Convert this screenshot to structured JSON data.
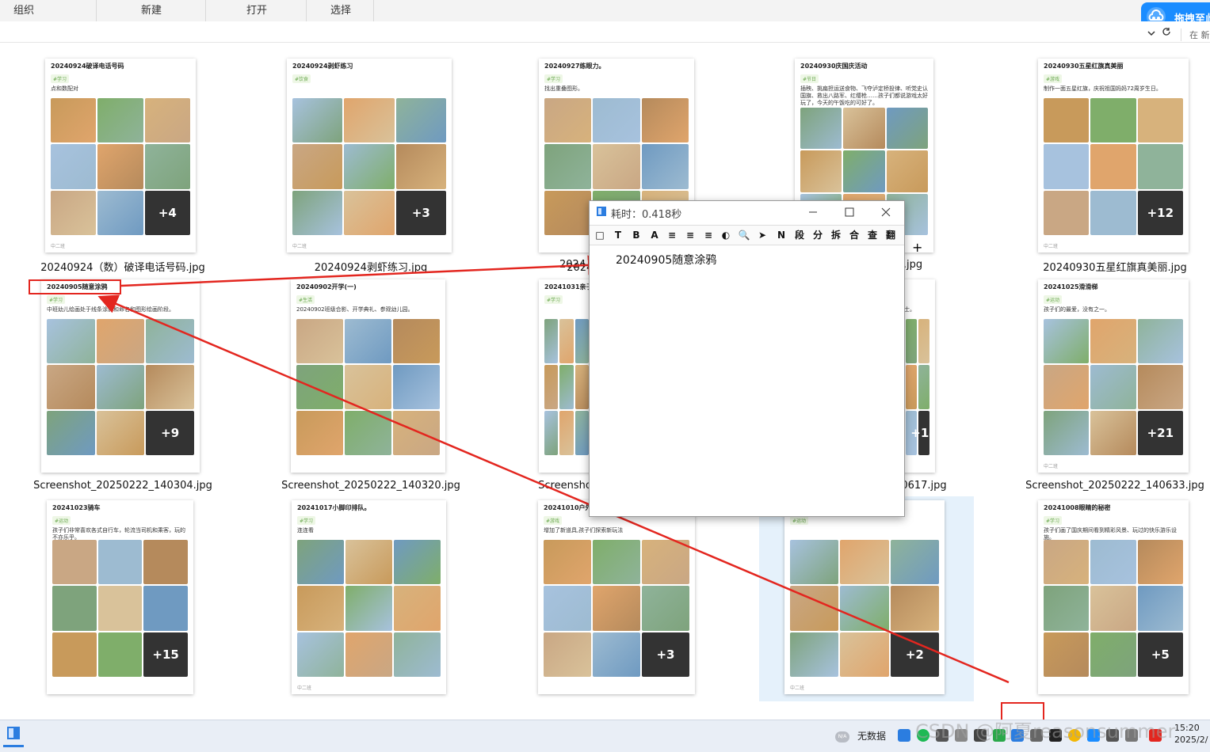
{
  "ribbon": {
    "tabs": [
      "组织",
      "新建",
      "打开",
      "选择"
    ],
    "drag_label": "拖拽至此",
    "search_placeholder": "在 新"
  },
  "files": [
    {
      "name": "20240924（数）破译电话号码.jpg",
      "title": "20240924破译电话号码",
      "tag": "#学习",
      "desc": "点和数配对",
      "more": "+4",
      "foot": "中二班"
    },
    {
      "name": "20240924剥虾练习.jpg",
      "title": "20240924剥虾练习",
      "tag": "#饮食",
      "desc": "",
      "more": "+3",
      "foot": "中二班"
    },
    {
      "name": "20240927练眼力.jpg",
      "title": "20240927练眼力。",
      "tag": "#学习",
      "desc": "找出重叠图形。",
      "more": "",
      "foot": ""
    },
    {
      "name": ".jpg",
      "title": "20240930庆国庆活动",
      "tag": "#节日",
      "desc": "插秧、挑扁担运送食物、飞夺泸定桥投律、听党史认国旗、救出八路军、红缨枪……孩子们都说游戏太好玩了，今天的午饭吃的可好了。",
      "more": "",
      "foot": ""
    },
    {
      "name": "20240930五星红旗真美丽.jpg",
      "title": "20240930五星红旗真美丽",
      "tag": "#游戏",
      "desc": "制作一面五星红旗，庆祝祖国妈妈72周岁生日。",
      "more": "+12",
      "foot": "中二班"
    },
    {
      "name": "Screenshot_20250222_140304.jpg",
      "title": "20240905随意涂鸦",
      "tag": "#学习",
      "desc": "中班幼儿绘画处于线条涂鸦和命名和图形绘画阶段。",
      "more": "+9",
      "foot": ""
    },
    {
      "name": "Screenshot_20250222_140320.jpg",
      "title": "20240902开学(一)",
      "tag": "#生活",
      "desc": "20240902班级合影、开学典礼、参观幼儿园。",
      "more": "",
      "foot": ""
    },
    {
      "name": "Screensho",
      "title": "20241031亲子",
      "tag": "#学习",
      "desc": "",
      "more": "",
      "foot": ""
    },
    {
      "name": "0617.jpg",
      "title": "",
      "tag": "",
      "desc": "、芝士。",
      "more": "+14",
      "foot": ""
    },
    {
      "name": "Screenshot_20250222_140633.jpg",
      "title": "20241025滑滑梯",
      "tag": "#运动",
      "desc": "孩子们的最爱，没有之一。",
      "more": "+21",
      "foot": "中二班"
    },
    {
      "name": "",
      "title": "20241023骑车",
      "tag": "#运动",
      "desc": "孩子们非常喜欢各式自行车，轮流当司机和乘客，玩的不亦乐乎。",
      "more": "+15",
      "foot": ""
    },
    {
      "name": "",
      "title": "20241017小脚印排队。",
      "tag": "#学习",
      "desc": "连连看",
      "more": "",
      "foot": "中二班"
    },
    {
      "name": "",
      "title": "20241010户外",
      "tag": "#游戏",
      "desc": "增加了新道具,孩子们探索新玩法",
      "more": "+3",
      "foot": ""
    },
    {
      "name": "",
      "title": "",
      "tag": "#运动",
      "desc": "",
      "more": "+2",
      "foot": "中二班"
    },
    {
      "name": "",
      "title": "20241008眼睛的秘密",
      "tag": "#学习",
      "desc": "孩子们画了国庆期间看到精彩风景、玩过的快乐游乐设施。",
      "more": "+5",
      "foot": ""
    }
  ],
  "popup": {
    "title": "耗时：0.418秒",
    "text": "20240905随意涂鸦",
    "tools": [
      "□",
      "T",
      "B",
      "A",
      "≡",
      "≡",
      "≡",
      "◐",
      "🔍",
      "➤",
      "N",
      "段",
      "分",
      "拆",
      "合",
      "查",
      "翻"
    ]
  },
  "taskbar": {
    "na_label": "N/A",
    "status": "无数据",
    "time": "15:20",
    "date": "2025/2/"
  },
  "watermark": "CSDN @阿夏reasonsummer",
  "colors": {
    "annotation": "#e3261f",
    "accent": "#1a8cff",
    "selection": "#e5f1fb"
  }
}
